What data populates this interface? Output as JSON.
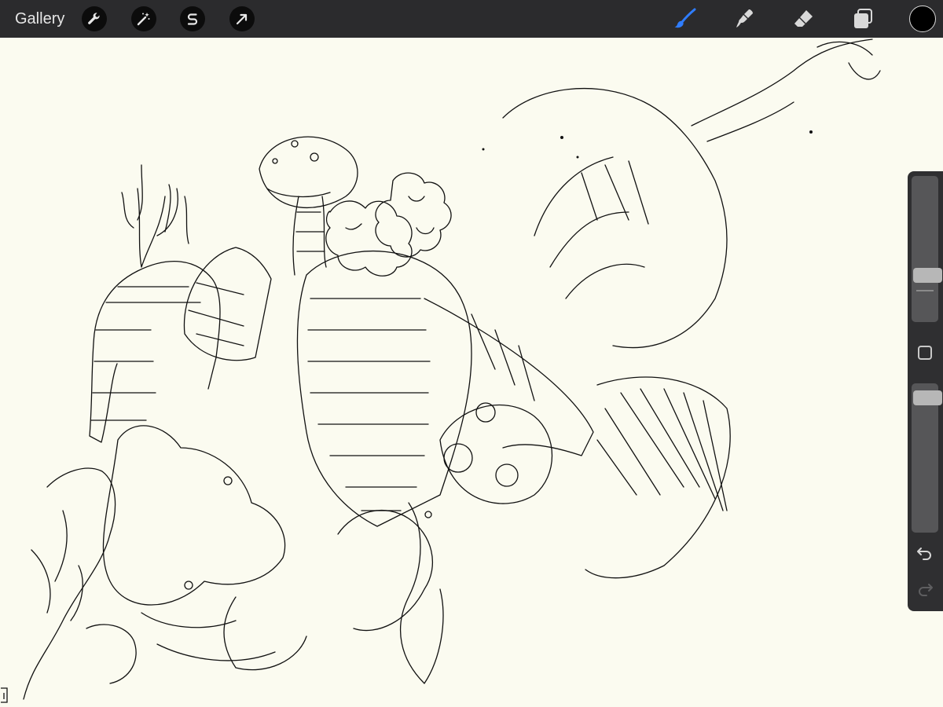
{
  "toolbar": {
    "gallery_label": "Gallery",
    "left_tools": [
      "wrench-icon",
      "magic-wand-icon",
      "selection-s-icon",
      "arrow-transform-icon"
    ],
    "right_tools": [
      "brush-icon",
      "smudge-icon",
      "eraser-icon",
      "layers-icon"
    ],
    "active_tool": "brush",
    "current_color": "#000000",
    "accent_color": "#2f7dff"
  },
  "sidebar": {
    "brush_size": 0.3,
    "brush_opacity": 0.95,
    "icons": [
      "modify-square-icon",
      "undo-icon",
      "redo-icon"
    ]
  },
  "canvas": {
    "background": "#fbfbf0",
    "stroke_color": "#000000"
  }
}
